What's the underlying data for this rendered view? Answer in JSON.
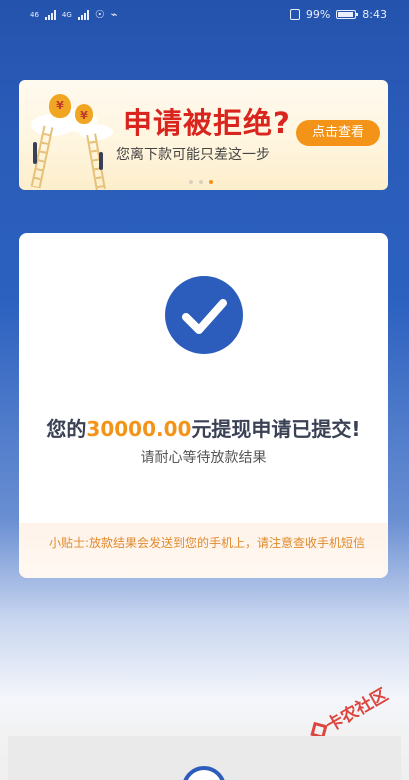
{
  "status_bar": {
    "sim1": "46",
    "sim2": "4G",
    "battery": "99%",
    "time": "8:43"
  },
  "banner": {
    "title": "申请被拒绝?",
    "subtitle": "您离下款可能只差这一步",
    "button": "点击查看",
    "coin_symbol": "¥",
    "slide_count": 3,
    "active_slide": 3
  },
  "result": {
    "prefix": "您的",
    "amount": "30000.00",
    "suffix": "元提现申请已提交!",
    "subtitle": "请耐心等待放款结果"
  },
  "tip": {
    "text": "小贴士:放款结果会发送到您的手机上，请注意查收手机短信"
  },
  "watermark": {
    "text": "卡农社区"
  },
  "colors": {
    "primary_blue": "#2c5cbc",
    "accent_orange": "#f39418",
    "banner_red": "#d9251d"
  }
}
